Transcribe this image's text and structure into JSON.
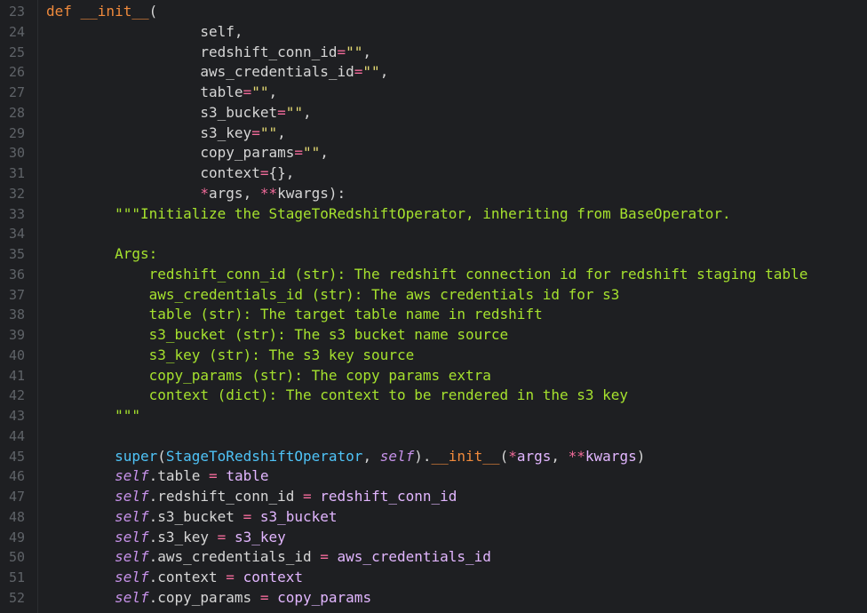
{
  "lines": [
    {
      "n": "23",
      "tokens": [
        [
          "kw",
          "def "
        ],
        [
          "fn",
          "__init__"
        ],
        [
          "plain",
          "("
        ]
      ]
    },
    {
      "n": "24",
      "tokens": [
        [
          "plain",
          "                  self,"
        ]
      ]
    },
    {
      "n": "25",
      "tokens": [
        [
          "plain",
          "                  redshift_conn_id"
        ],
        [
          "op",
          "="
        ],
        [
          "str",
          "\"\""
        ],
        [
          "plain",
          ","
        ]
      ]
    },
    {
      "n": "26",
      "tokens": [
        [
          "plain",
          "                  aws_credentials_id"
        ],
        [
          "op",
          "="
        ],
        [
          "str",
          "\"\""
        ],
        [
          "plain",
          ","
        ]
      ]
    },
    {
      "n": "27",
      "tokens": [
        [
          "plain",
          "                  table"
        ],
        [
          "op",
          "="
        ],
        [
          "str",
          "\"\""
        ],
        [
          "plain",
          ","
        ]
      ]
    },
    {
      "n": "28",
      "tokens": [
        [
          "plain",
          "                  s3_bucket"
        ],
        [
          "op",
          "="
        ],
        [
          "str",
          "\"\""
        ],
        [
          "plain",
          ","
        ]
      ]
    },
    {
      "n": "29",
      "tokens": [
        [
          "plain",
          "                  s3_key"
        ],
        [
          "op",
          "="
        ],
        [
          "str",
          "\"\""
        ],
        [
          "plain",
          ","
        ]
      ]
    },
    {
      "n": "30",
      "tokens": [
        [
          "plain",
          "                  copy_params"
        ],
        [
          "op",
          "="
        ],
        [
          "str",
          "\"\""
        ],
        [
          "plain",
          ","
        ]
      ]
    },
    {
      "n": "31",
      "tokens": [
        [
          "plain",
          "                  context"
        ],
        [
          "op",
          "="
        ],
        [
          "plain",
          "{},"
        ]
      ]
    },
    {
      "n": "32",
      "tokens": [
        [
          "plain",
          "                  "
        ],
        [
          "op",
          "*"
        ],
        [
          "plain",
          "args, "
        ],
        [
          "op",
          "**"
        ],
        [
          "plain",
          "kwargs):"
        ]
      ]
    },
    {
      "n": "33",
      "tokens": [
        [
          "doc",
          "        \"\"\"Initialize the StageToRedshiftOperator, inheriting from BaseOperator."
        ]
      ]
    },
    {
      "n": "34",
      "tokens": [
        [
          "doc",
          ""
        ]
      ]
    },
    {
      "n": "35",
      "tokens": [
        [
          "doc",
          "        Args:"
        ]
      ]
    },
    {
      "n": "36",
      "tokens": [
        [
          "doc",
          "            redshift_conn_id (str): The redshift connection id for redshift staging table"
        ]
      ]
    },
    {
      "n": "37",
      "tokens": [
        [
          "doc",
          "            aws_credentials_id (str): The aws credentials id for s3"
        ]
      ]
    },
    {
      "n": "38",
      "tokens": [
        [
          "doc",
          "            table (str): The target table name in redshift"
        ]
      ]
    },
    {
      "n": "39",
      "tokens": [
        [
          "doc",
          "            s3_bucket (str): The s3 bucket name source"
        ]
      ]
    },
    {
      "n": "40",
      "tokens": [
        [
          "doc",
          "            s3_key (str): The s3 key source"
        ]
      ]
    },
    {
      "n": "41",
      "tokens": [
        [
          "doc",
          "            copy_params (str): The copy params extra"
        ]
      ]
    },
    {
      "n": "42",
      "tokens": [
        [
          "doc",
          "            context (dict): The context to be rendered in the s3 key"
        ]
      ]
    },
    {
      "n": "43",
      "tokens": [
        [
          "doc",
          "        \"\"\""
        ]
      ]
    },
    {
      "n": "44",
      "tokens": [
        [
          "plain",
          ""
        ]
      ]
    },
    {
      "n": "45",
      "tokens": [
        [
          "plain",
          "        "
        ],
        [
          "builtin",
          "super"
        ],
        [
          "plain",
          "("
        ],
        [
          "cls",
          "StageToRedshiftOperator"
        ],
        [
          "plain",
          ", "
        ],
        [
          "self",
          "self"
        ],
        [
          "plain",
          ")."
        ],
        [
          "fn",
          "__init__"
        ],
        [
          "plain",
          "("
        ],
        [
          "op",
          "*"
        ],
        [
          "name",
          "args"
        ],
        [
          "plain",
          ", "
        ],
        [
          "op",
          "**"
        ],
        [
          "name",
          "kwargs"
        ],
        [
          "plain",
          ")"
        ]
      ]
    },
    {
      "n": "46",
      "tokens": [
        [
          "plain",
          "        "
        ],
        [
          "self",
          "self"
        ],
        [
          "plain",
          ".table "
        ],
        [
          "op",
          "="
        ],
        [
          "plain",
          " "
        ],
        [
          "name",
          "table"
        ]
      ]
    },
    {
      "n": "47",
      "tokens": [
        [
          "plain",
          "        "
        ],
        [
          "self",
          "self"
        ],
        [
          "plain",
          ".redshift_conn_id "
        ],
        [
          "op",
          "="
        ],
        [
          "plain",
          " "
        ],
        [
          "name",
          "redshift_conn_id"
        ]
      ]
    },
    {
      "n": "48",
      "tokens": [
        [
          "plain",
          "        "
        ],
        [
          "self",
          "self"
        ],
        [
          "plain",
          ".s3_bucket "
        ],
        [
          "op",
          "="
        ],
        [
          "plain",
          " "
        ],
        [
          "name",
          "s3_bucket"
        ]
      ]
    },
    {
      "n": "49",
      "tokens": [
        [
          "plain",
          "        "
        ],
        [
          "self",
          "self"
        ],
        [
          "plain",
          ".s3_key "
        ],
        [
          "op",
          "="
        ],
        [
          "plain",
          " "
        ],
        [
          "name",
          "s3_key"
        ]
      ]
    },
    {
      "n": "50",
      "tokens": [
        [
          "plain",
          "        "
        ],
        [
          "self",
          "self"
        ],
        [
          "plain",
          ".aws_credentials_id "
        ],
        [
          "op",
          "="
        ],
        [
          "plain",
          " "
        ],
        [
          "name",
          "aws_credentials_id"
        ]
      ]
    },
    {
      "n": "51",
      "tokens": [
        [
          "plain",
          "        "
        ],
        [
          "self",
          "self"
        ],
        [
          "plain",
          ".context "
        ],
        [
          "op",
          "="
        ],
        [
          "plain",
          " "
        ],
        [
          "name",
          "context"
        ]
      ]
    },
    {
      "n": "52",
      "tokens": [
        [
          "plain",
          "        "
        ],
        [
          "self",
          "self"
        ],
        [
          "plain",
          ".copy_params "
        ],
        [
          "op",
          "="
        ],
        [
          "plain",
          " "
        ],
        [
          "name",
          "copy_params"
        ]
      ]
    }
  ]
}
